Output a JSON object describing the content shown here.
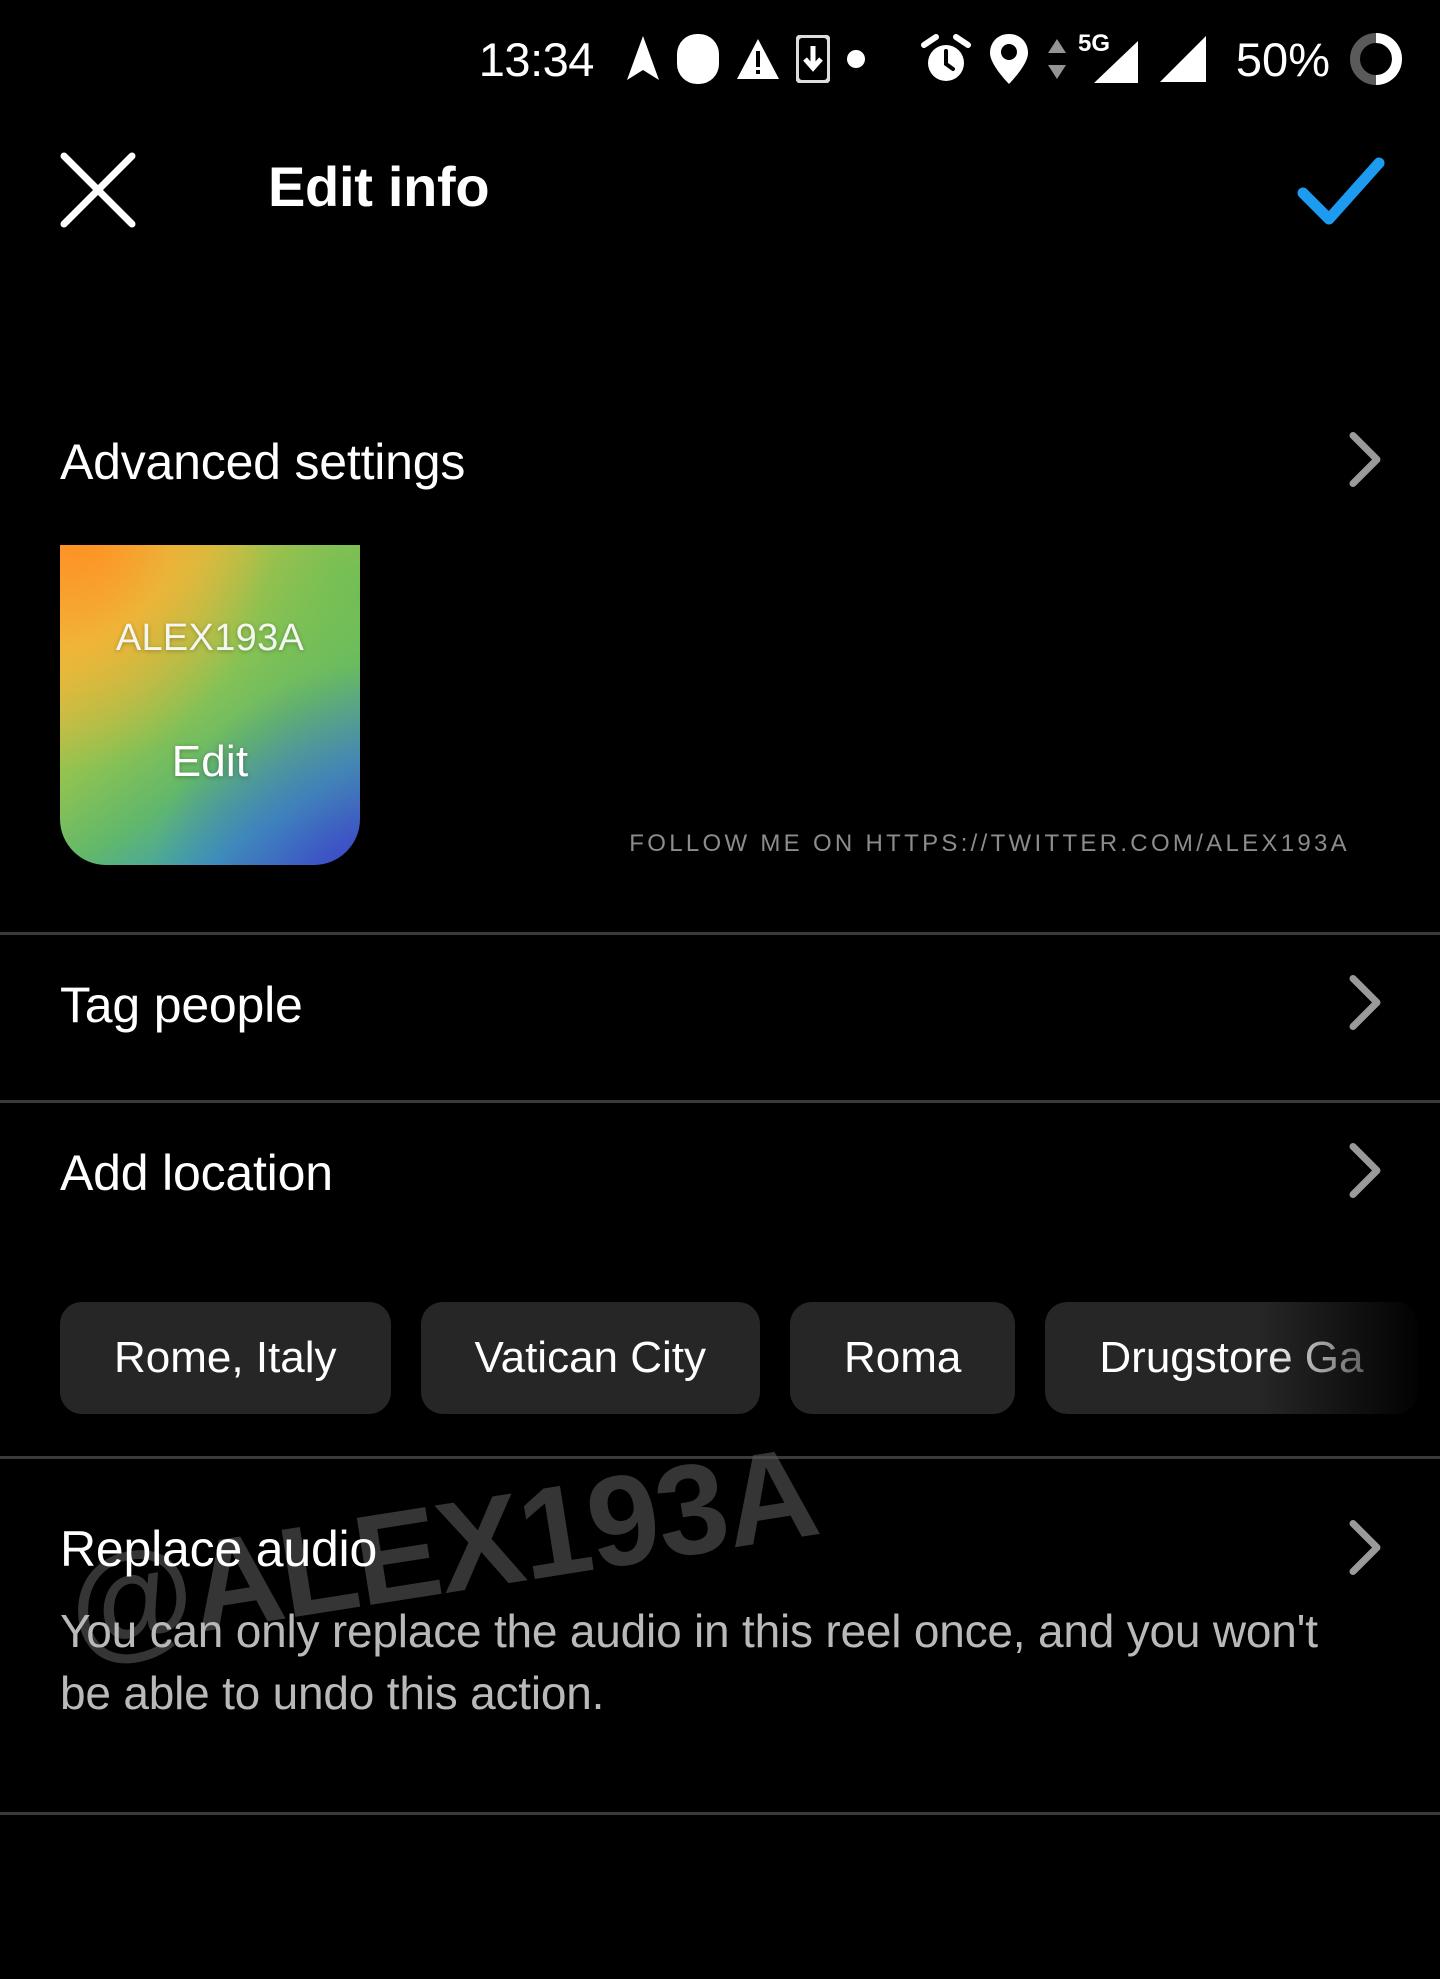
{
  "status_bar": {
    "time": "13:34",
    "battery_percent": "50%",
    "network_label": "5G",
    "icons": [
      "navigation-arrow-icon",
      "rounded-square-icon",
      "warning-triangle-icon",
      "phone-download-icon",
      "dot-icon",
      "alarm-clock-icon",
      "location-pin-icon",
      "data-transfer-arrows-icon",
      "signal-bars-icon",
      "signal-bars-2-icon",
      "battery-ring-icon"
    ]
  },
  "app_bar": {
    "title": "Edit info",
    "close_icon": "close-icon",
    "confirm_icon": "check-icon",
    "confirm_color": "#1d9bf0"
  },
  "rows": {
    "advanced_settings": "Advanced settings",
    "tag_people": "Tag people",
    "add_location": "Add location",
    "replace_audio": "Replace audio",
    "replace_audio_description": "You can only replace the audio in this reel once, and you won't be able to undo this action."
  },
  "thumbnail": {
    "username": "ALEX193A",
    "edit_label": "Edit"
  },
  "follow_note": "FOLLOW ME ON HTTPS://TWITTER.COM/ALEX193A",
  "watermark": "@ALEX193A",
  "location_chips": [
    {
      "label": "Rome, Italy"
    },
    {
      "label": "Vatican City"
    },
    {
      "label": "Roma"
    },
    {
      "label": "Drugstore Ga"
    }
  ],
  "colors": {
    "background": "#000000",
    "divider": "#3a3a3a",
    "chip_background": "#262626",
    "accent": "#1d9bf0",
    "secondary_text": "#b9b9b9"
  }
}
